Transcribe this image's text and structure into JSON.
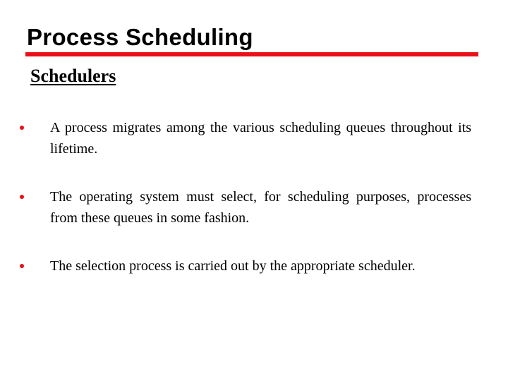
{
  "slide": {
    "title": "Process Scheduling",
    "subtitle": "Schedulers",
    "accent_color": "#e8101a",
    "bullet_color": "#e8101a",
    "bullets": [
      {
        "text": "A process migrates among the various scheduling queues throughout its lifetime."
      },
      {
        "text": "The operating system must select, for scheduling purposes, processes from these queues in some fashion."
      },
      {
        "text": "The selection process is carried out by the appropriate scheduler."
      }
    ]
  }
}
